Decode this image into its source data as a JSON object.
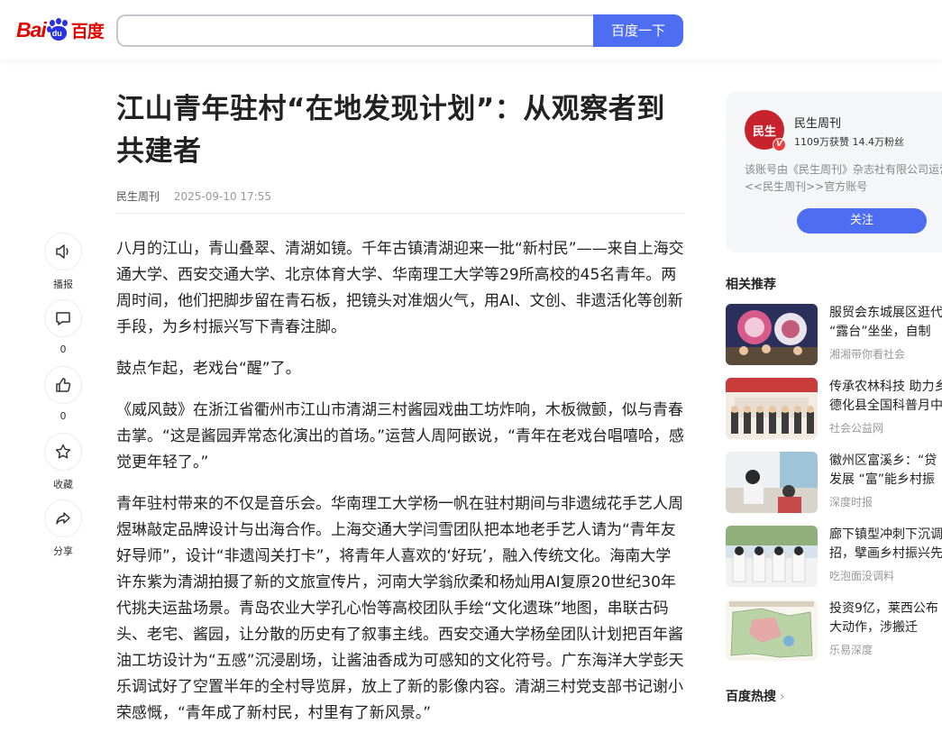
{
  "header": {
    "logo_bai": "Bai",
    "logo_du": "du",
    "logo_cn": "百度",
    "search_value": "",
    "search_button": "百度一下"
  },
  "article": {
    "title": "江山青年驻村“在地发现计划”：从观察者到共建者",
    "author": "民生周刊",
    "date": "2025-09-10 17:55",
    "paragraphs": [
      "八月的江山，青山叠翠、清湖如镜。千年古镇清湖迎来一批“新村民”——来自上海交通大学、西安交通大学、北京体育大学、华南理工大学等29所高校的45名青年。两周时间，他们把脚步留在青石板，把镜头对准烟火气，用AI、文创、非遗活化等创新手段，为乡村振兴写下青春注脚。",
      "鼓点乍起，老戏台“醒”了。",
      "《威风鼓》在浙江省衢州市江山市清湖三村酱园戏曲工坊炸响，木板微颤，似与青春击掌。“这是酱园弄常态化演出的首场。”运营人周阿嵌说，“青年在老戏台唱嘻哈，感觉更年轻了。”",
      "青年驻村带来的不仅是音乐会。华南理工大学杨一帆在驻村期间与非遗绒花手艺人周煜琳敲定品牌设计与出海合作。上海交通大学闫雪团队把本地老手艺人请为“青年友好导师”，设计“非遗闯关打卡”，将青年人喜欢的‘好玩’，融入传统文化。海南大学许东紫为清湖拍摄了新的文旅宣传片，河南大学翁欣柔和杨灿用AI复原20世纪30年代挑夫运盐场景。青岛农业大学孔心怡等高校团队手绘“文化遗珠”地图，串联古码头、老宅、酱园，让分散的历史有了叙事主线。西安交通大学杨垒团队计划把百年酱油工坊设计为“五感”沉浸剧场，让酱油香成为可感知的文化符号。广东海洋大学彭天乐调试好了空置半年的全村导览屏，放上了新的影像内容。清湖三村党支部书记谢小荣感慨，“青年成了新村民，村里有了新风景。”"
    ]
  },
  "actions": [
    {
      "label": "播报",
      "icon": "speaker-icon"
    },
    {
      "label": "0",
      "icon": "comment-icon"
    },
    {
      "label": "0",
      "icon": "thumbs-up-icon"
    },
    {
      "label": "收藏",
      "icon": "star-icon"
    },
    {
      "label": "分享",
      "icon": "share-icon"
    }
  ],
  "author_card": {
    "avatar_text": "民生",
    "verified": "V",
    "name": "民生周刊",
    "stats": "1109万获赞 14.4万粉丝",
    "desc_line1": "该账号由《民生周刊》杂志社有限公司运营",
    "desc_line2": "<<民生周刊>>官方账号",
    "follow": "关注"
  },
  "related": {
    "heading": "相关推荐",
    "items": [
      {
        "line1": "服贸会东城展区逛代",
        "line2": "“露台”坐坐，自制",
        "source": "湘湘带你看社会"
      },
      {
        "line1": "传承农林科技 助力乡",
        "line2": "德化县全国科普月中",
        "source": "社会公益网"
      },
      {
        "line1": "徽州区富溪乡：“贷",
        "line2": "发展 “富”能乡村振",
        "source": "深度时报"
      },
      {
        "line1": "廊下镇型冲刺下沉调",
        "line2": "招，擘画乡村振兴先",
        "source": "吃泡面没调料"
      },
      {
        "line1": "投资9亿，莱西公布",
        "line2": "大动作，涉搬迁",
        "source": "乐易深度"
      }
    ]
  },
  "hot": {
    "heading": "百度热搜",
    "chevron": "›"
  }
}
